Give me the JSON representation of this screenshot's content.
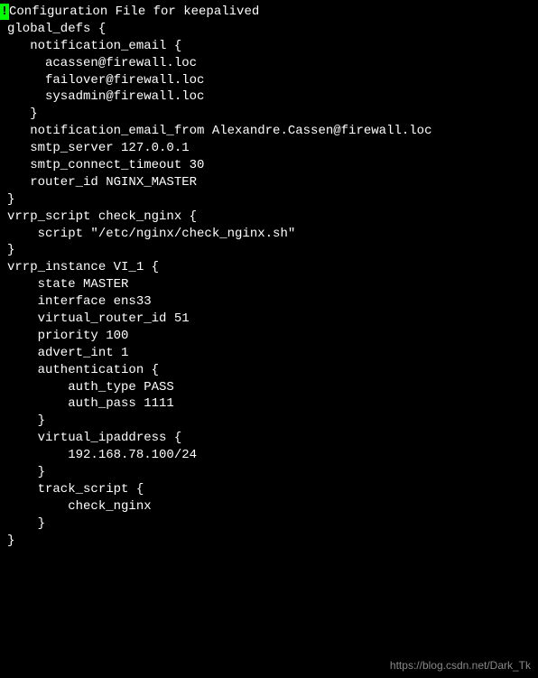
{
  "marker": "!",
  "lines": {
    "l0": " Configuration File for keepalived",
    "l1": "",
    "l2": "global_defs {",
    "l3": "   notification_email {",
    "l4": "     acassen@firewall.loc",
    "l5": "     failover@firewall.loc",
    "l6": "     sysadmin@firewall.loc",
    "l7": "   }",
    "l8": "   notification_email_from Alexandre.Cassen@firewall.loc",
    "l9": "   smtp_server 127.0.0.1",
    "l10": "   smtp_connect_timeout 30",
    "l11": "   router_id NGINX_MASTER",
    "l12": "}",
    "l13": "",
    "l14": "vrrp_script check_nginx {",
    "l15": "    script \"/etc/nginx/check_nginx.sh\"",
    "l16": "}",
    "l17": "",
    "l18": "",
    "l19": "vrrp_instance VI_1 {",
    "l20": "    state MASTER",
    "l21": "    interface ens33",
    "l22": "    virtual_router_id 51",
    "l23": "    priority 100",
    "l24": "    advert_int 1",
    "l25": "    authentication {",
    "l26": "        auth_type PASS",
    "l27": "        auth_pass 1111",
    "l28": "    }",
    "l29": "    virtual_ipaddress {",
    "l30": "        192.168.78.100/24 ",
    "l31": "    }",
    "l32": "    track_script {",
    "l33": "        check_nginx",
    "l34": "    }",
    "l35": "}"
  },
  "watermark": "https://blog.csdn.net/Dark_Tk"
}
